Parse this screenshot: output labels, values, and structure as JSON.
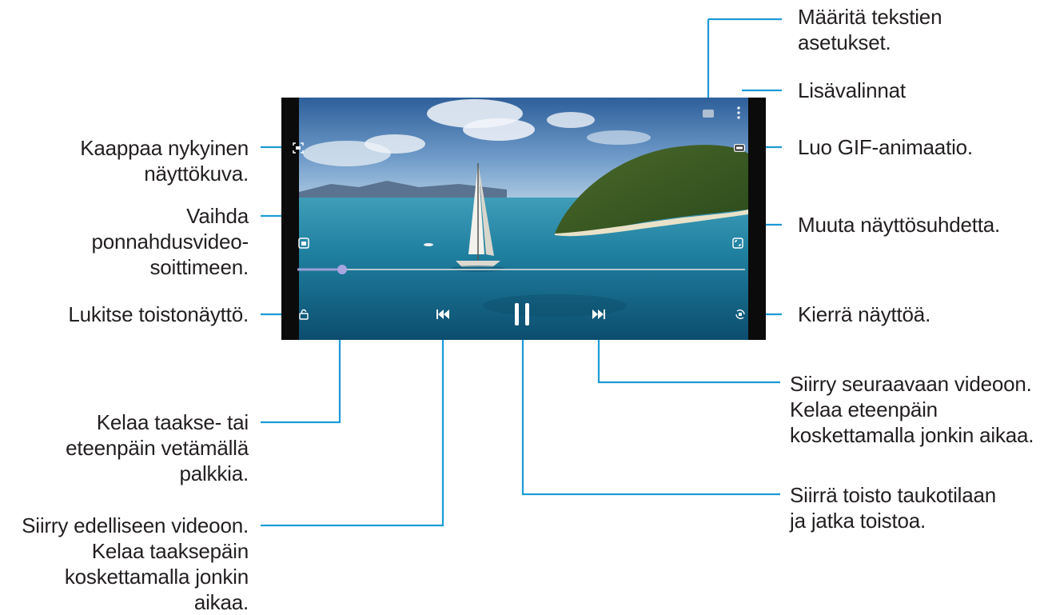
{
  "callouts": {
    "text_settings": "Määritä tekstien\nasetukset.",
    "more_options": "Lisävalinnat",
    "create_gif": "Luo GIF-animaatio.",
    "aspect_ratio": "Muuta näyttösuhdetta.",
    "rotate": "Kierrä näyttöä.",
    "next_video": "Siirry seuraavaan videoon.\nKelaa eteenpäin\nkoskettamalla jonkin aikaa.",
    "pause": "Siirrä toisto taukotilaan\nja jatka toistoa.",
    "capture": "Kaappaa nykyinen\nnäyttökuva.",
    "popup": "Vaihda\nponnahdusvideo-\nsoittimeen.",
    "lock": "Lukitse toistonäyttö.",
    "seek": "Kelaa taakse- tai\neteenpäin vetämällä\npalkkia.",
    "previous_video": "Siirry edelliseen videoon.\nKelaa taaksepäin\nkoskettamalla jonkin\naikaa."
  },
  "player": {
    "progress": 0.1,
    "icons": [
      "capture-icon",
      "popup-player-icon",
      "lock-icon",
      "rewind-icon",
      "pause-icon",
      "fast-forward-icon",
      "rotate-icon",
      "aspect-ratio-icon",
      "gif-icon",
      "more-options-icon",
      "subtitles-icon"
    ]
  },
  "colors": {
    "leader": "#1d9ad6",
    "text": "#231f20"
  }
}
